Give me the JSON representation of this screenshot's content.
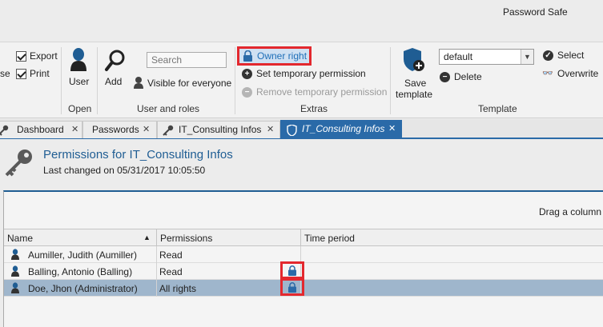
{
  "app": {
    "title": "Password Safe"
  },
  "ribbon": {
    "close_partial": "se",
    "export_label": "Export",
    "print_label": "Print",
    "open_group": {
      "user_label": "User",
      "group_label": "Open"
    },
    "users_group": {
      "add_label": "Add",
      "search_placeholder": "Search",
      "visible_label": "Visible for everyone",
      "group_label": "User and roles"
    },
    "extras_group": {
      "owner_right_label": "Owner right",
      "set_temp_label": "Set temporary permission",
      "remove_temp_label": "Remove temporary permission",
      "group_label": "Extras"
    },
    "template_group": {
      "save_label_1": "Save",
      "save_label_2": "template",
      "dropdown_value": "default",
      "delete_label": "Delete",
      "select_label": "Select",
      "overwrite_label": "Overwrite",
      "group_label": "Template"
    }
  },
  "tabs": [
    {
      "label": "Dashboard",
      "active": false
    },
    {
      "label": "Passwords",
      "active": false
    },
    {
      "label": "IT_Consulting Infos",
      "active": false
    },
    {
      "label": "IT_Consulting Infos",
      "active": true
    }
  ],
  "header": {
    "title": "Permissions for IT_Consulting Infos",
    "subtitle": "Last changed on 05/31/2017 10:05:50"
  },
  "grid": {
    "drag_hint": "Drag a column",
    "columns": [
      "Name",
      "Permissions",
      "Time period"
    ],
    "rows": [
      {
        "name": "Aumiller, Judith (Aumiller)",
        "permission": "Read",
        "owner": false,
        "selected": false
      },
      {
        "name": "Balling, Antonio (Balling)",
        "permission": "Read",
        "owner": true,
        "selected": false
      },
      {
        "name": "Doe, Jhon (Administrator)",
        "permission": "All rights",
        "owner": true,
        "selected": true
      }
    ]
  },
  "colors": {
    "accent": "#2a6aa8",
    "highlight": "#e3282e",
    "selected_row": "#9fb6cc"
  }
}
